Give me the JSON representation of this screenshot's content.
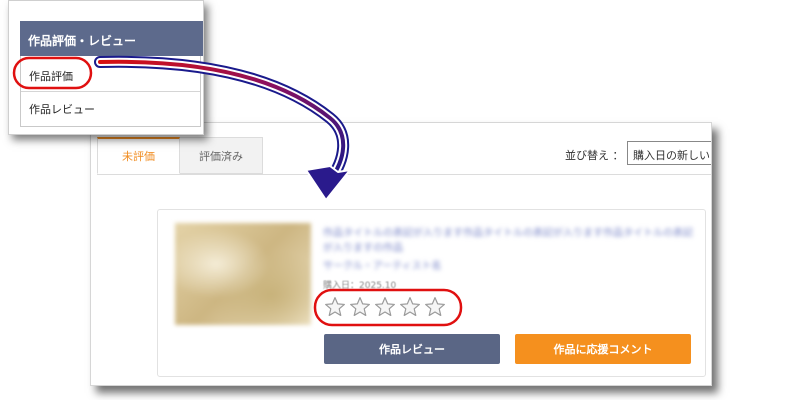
{
  "menu": {
    "header": "作品評価・レビュー",
    "items": [
      {
        "label": "作品評価"
      },
      {
        "label": "作品レビュー"
      }
    ]
  },
  "tabs": [
    {
      "label": "未評価",
      "active": true
    },
    {
      "label": "評価済み",
      "active": false
    }
  ],
  "sort": {
    "label": "並び替え ：",
    "selected": "購入日の新しい"
  },
  "item": {
    "title": "作品タイトルの表記が入ります作品タイトルの表記が入ります作品タイトルの表記が入りますの作品",
    "author": "サークル・アーティスト名",
    "purchase_label": "購入日：",
    "purchase_date": "2025.10",
    "rating_max": 5,
    "rating": 0,
    "review_button": "作品レビュー",
    "support_button": "作品に応援コメント"
  },
  "colors": {
    "accent_orange": "#f5901e",
    "header_navy": "#5d6a8c",
    "annotation_red": "#e01010",
    "arrow_blue": "#1a1a8c"
  }
}
